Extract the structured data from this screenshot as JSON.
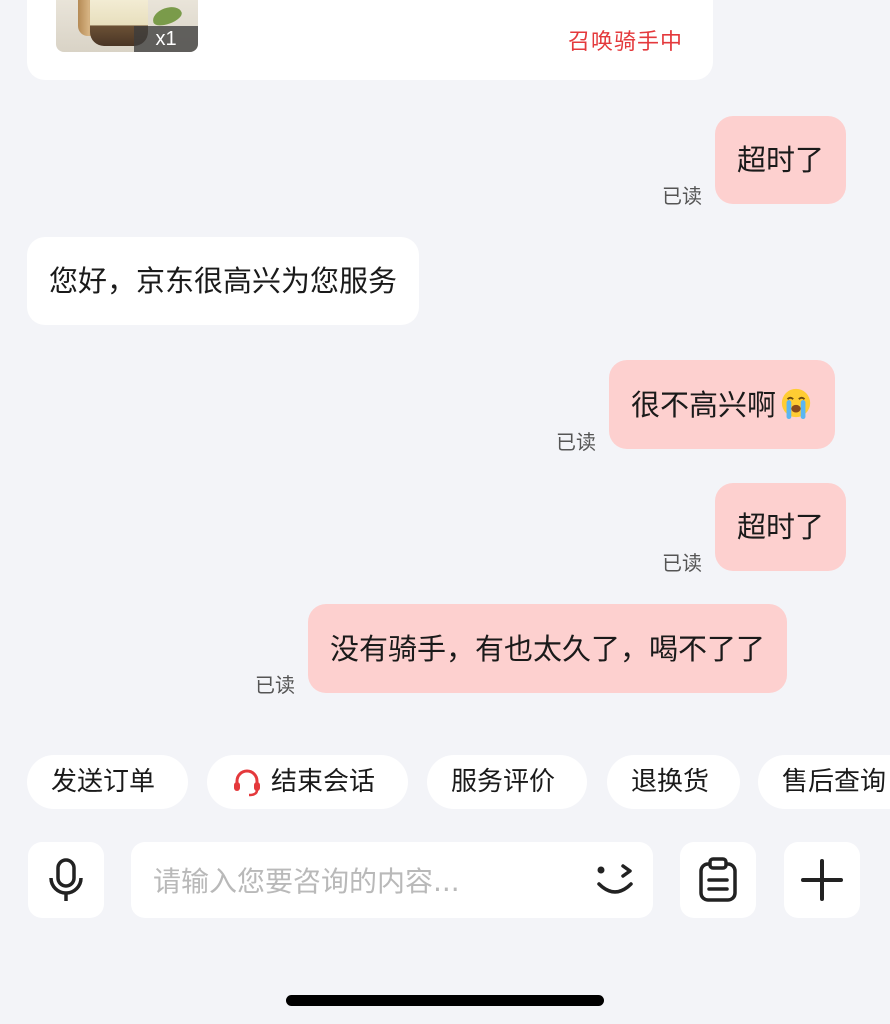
{
  "order_card": {
    "quantity_label": "x1",
    "status_text": "召唤骑手中"
  },
  "messages": [
    {
      "side": "me",
      "text": "超时了",
      "read_label": "已读"
    },
    {
      "side": "them",
      "text": "您好，京东很高兴为您服务"
    },
    {
      "side": "me",
      "text": "很不高兴啊",
      "emoji": "loudly-crying-face-icon",
      "read_label": "已读"
    },
    {
      "side": "me",
      "text": "超时了",
      "read_label": "已读"
    },
    {
      "side": "me",
      "text": "没有骑手，有也太久了，喝不了了",
      "read_label": "已读"
    }
  ],
  "quick_actions": [
    {
      "label": "发送订单"
    },
    {
      "label": "结束会话",
      "icon": "headset-icon"
    },
    {
      "label": "服务评价"
    },
    {
      "label": "退换货"
    },
    {
      "label": "售后查询"
    }
  ],
  "composer": {
    "voice_icon": "microphone-icon",
    "input_value": "",
    "input_placeholder": "请输入您要咨询的内容...",
    "emoji_icon": "wink-face-icon",
    "clipboard_icon": "clipboard-icon",
    "plus_icon": "plus-icon"
  },
  "colors": {
    "background": "#f3f4f8",
    "my_bubble": "#fdd0cf",
    "their_bubble": "#ffffff",
    "status_red": "#e4393c",
    "headset_red": "#e4393c"
  }
}
